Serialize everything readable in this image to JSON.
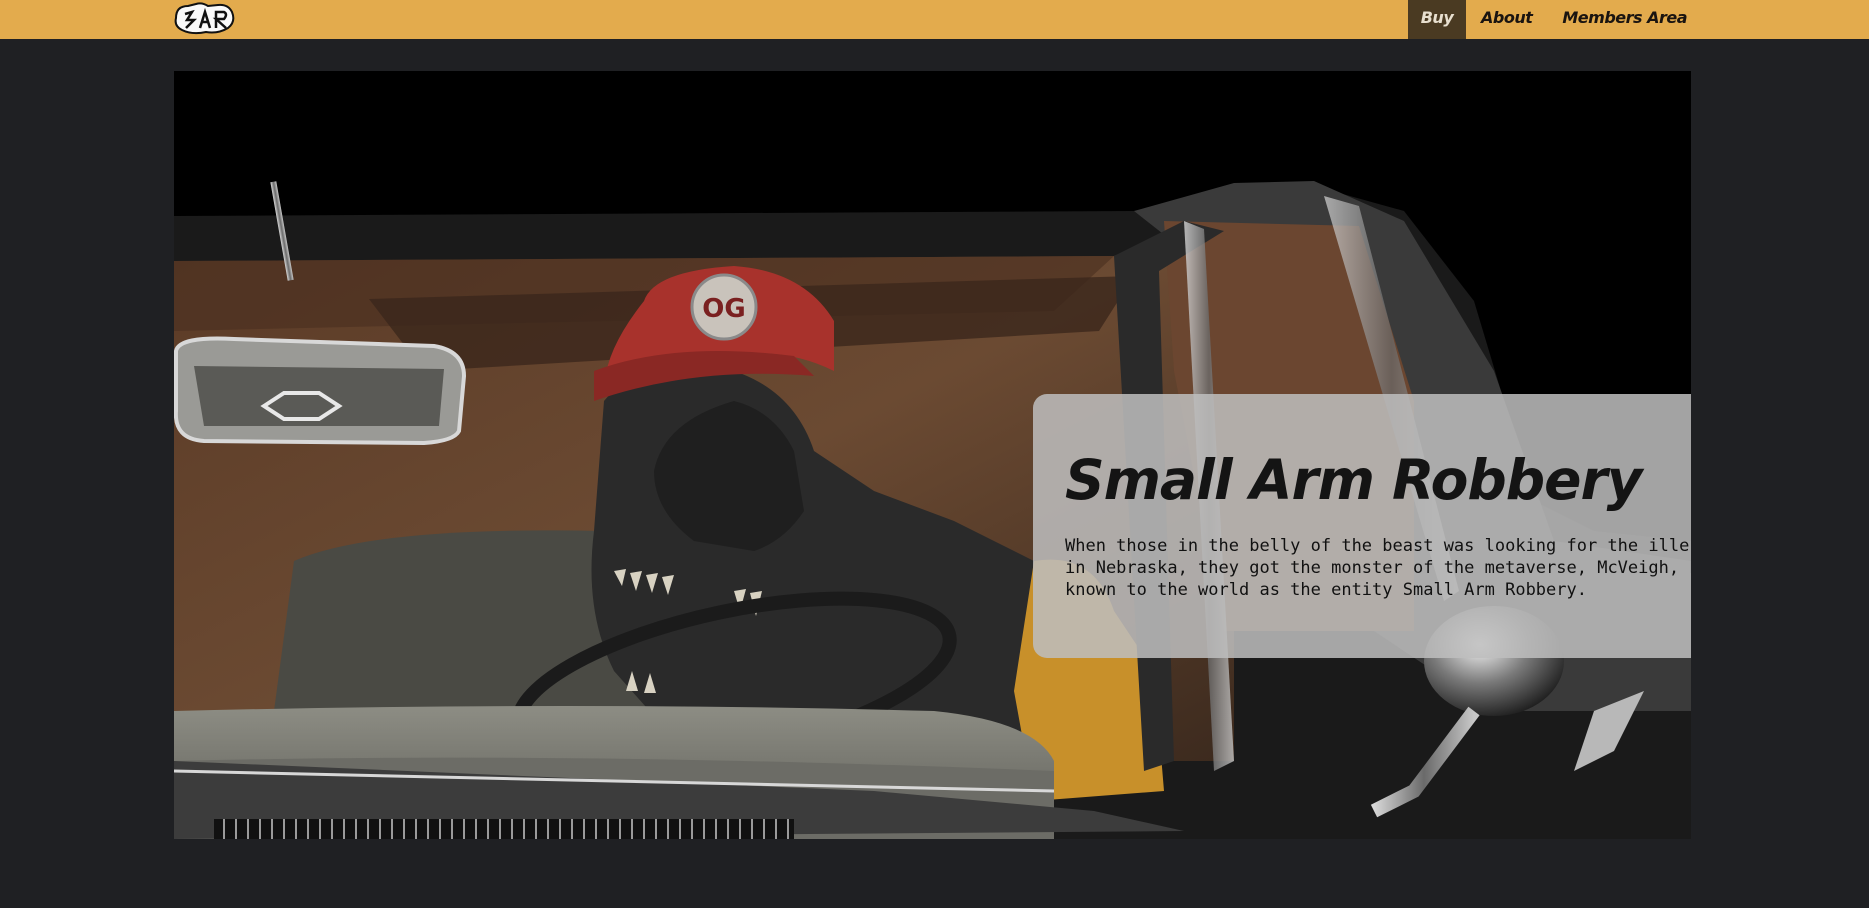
{
  "header": {
    "logo_text": "SAR",
    "nav": [
      {
        "label": "Buy",
        "active": true
      },
      {
        "label": "About",
        "active": false
      },
      {
        "label": "Members Area",
        "active": false
      }
    ]
  },
  "hero": {
    "title": "Small Arm Robbery",
    "description": "When those in the belly of the beast was looking for the illest cat in Nebraska, they got the monster of the metaverse, McVeigh, better known to the world as the entity Small Arm Robbery.",
    "hat_badge": "OG"
  },
  "colors": {
    "nav_bg": "#e3ab4d",
    "nav_active_bg": "#4a3a22",
    "page_bg": "#1f2023",
    "card_bg": "rgba(190,190,190,0.86)"
  }
}
